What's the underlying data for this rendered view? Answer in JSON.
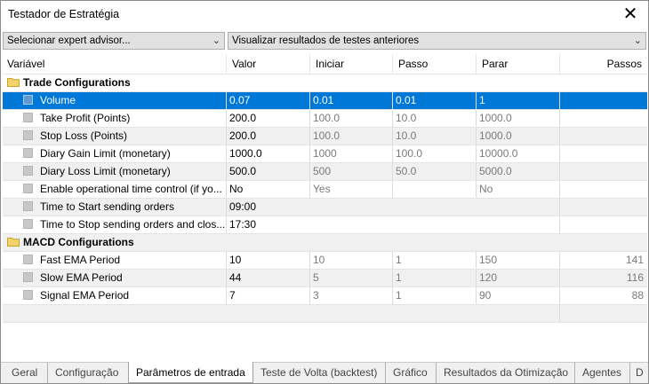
{
  "window": {
    "title": "Testador de Estratégia",
    "close_symbol": "✕"
  },
  "toolbar": {
    "expert_select": "Selecionar expert advisor...",
    "results_select": "Visualizar resultados de testes anteriores"
  },
  "columns": [
    "Variável",
    "Valor",
    "Iniciar",
    "Passo",
    "Parar",
    "Passos"
  ],
  "groups": [
    {
      "label": "Trade Configurations"
    },
    {
      "label": "MACD Configurations"
    }
  ],
  "rows": [
    {
      "name": "Volume",
      "valor": "0.07",
      "iniciar": "0.01",
      "passo": "0.01",
      "parar": "1",
      "passos": ""
    },
    {
      "name": "Take Profit (Points)",
      "valor": "200.0",
      "iniciar": "100.0",
      "passo": "10.0",
      "parar": "1000.0",
      "passos": ""
    },
    {
      "name": "Stop Loss (Points)",
      "valor": "200.0",
      "iniciar": "100.0",
      "passo": "10.0",
      "parar": "1000.0",
      "passos": ""
    },
    {
      "name": "Diary Gain Limit (monetary)",
      "valor": "1000.0",
      "iniciar": "1000",
      "passo": "100.0",
      "parar": "10000.0",
      "passos": ""
    },
    {
      "name": "Diary Loss Limit (monetary)",
      "valor": "500.0",
      "iniciar": "500",
      "passo": "50.0",
      "parar": "5000.0",
      "passos": ""
    },
    {
      "name": "Enable operational time control (if yo...",
      "valor": "No",
      "iniciar": "Yes",
      "passo": "",
      "parar": "No",
      "passos": ""
    },
    {
      "name": "Time to Start sending orders",
      "valor": "09:00",
      "iniciar": "",
      "passo": "",
      "parar": "",
      "passos": ""
    },
    {
      "name": "Time to Stop sending orders and clos...",
      "valor": "17:30",
      "iniciar": "",
      "passo": "",
      "parar": "",
      "passos": ""
    },
    {
      "name": "Fast EMA Period",
      "valor": "10",
      "iniciar": "10",
      "passo": "1",
      "parar": "150",
      "passos": "141"
    },
    {
      "name": "Slow EMA Period",
      "valor": "44",
      "iniciar": "5",
      "passo": "1",
      "parar": "120",
      "passos": "116"
    },
    {
      "name": "Signal EMA Period",
      "valor": "7",
      "iniciar": "3",
      "passo": "1",
      "parar": "90",
      "passos": "88"
    }
  ],
  "tabs": [
    "Geral",
    "Configuração",
    "Parâmetros de entrada",
    "Teste de Volta (backtest)",
    "Gráfico",
    "Resultados da Otimização",
    "Agentes",
    "D"
  ],
  "colors": {
    "selection": "#0078d7",
    "row_alt": "#f0f0f0",
    "folder": "#e8c44a"
  }
}
